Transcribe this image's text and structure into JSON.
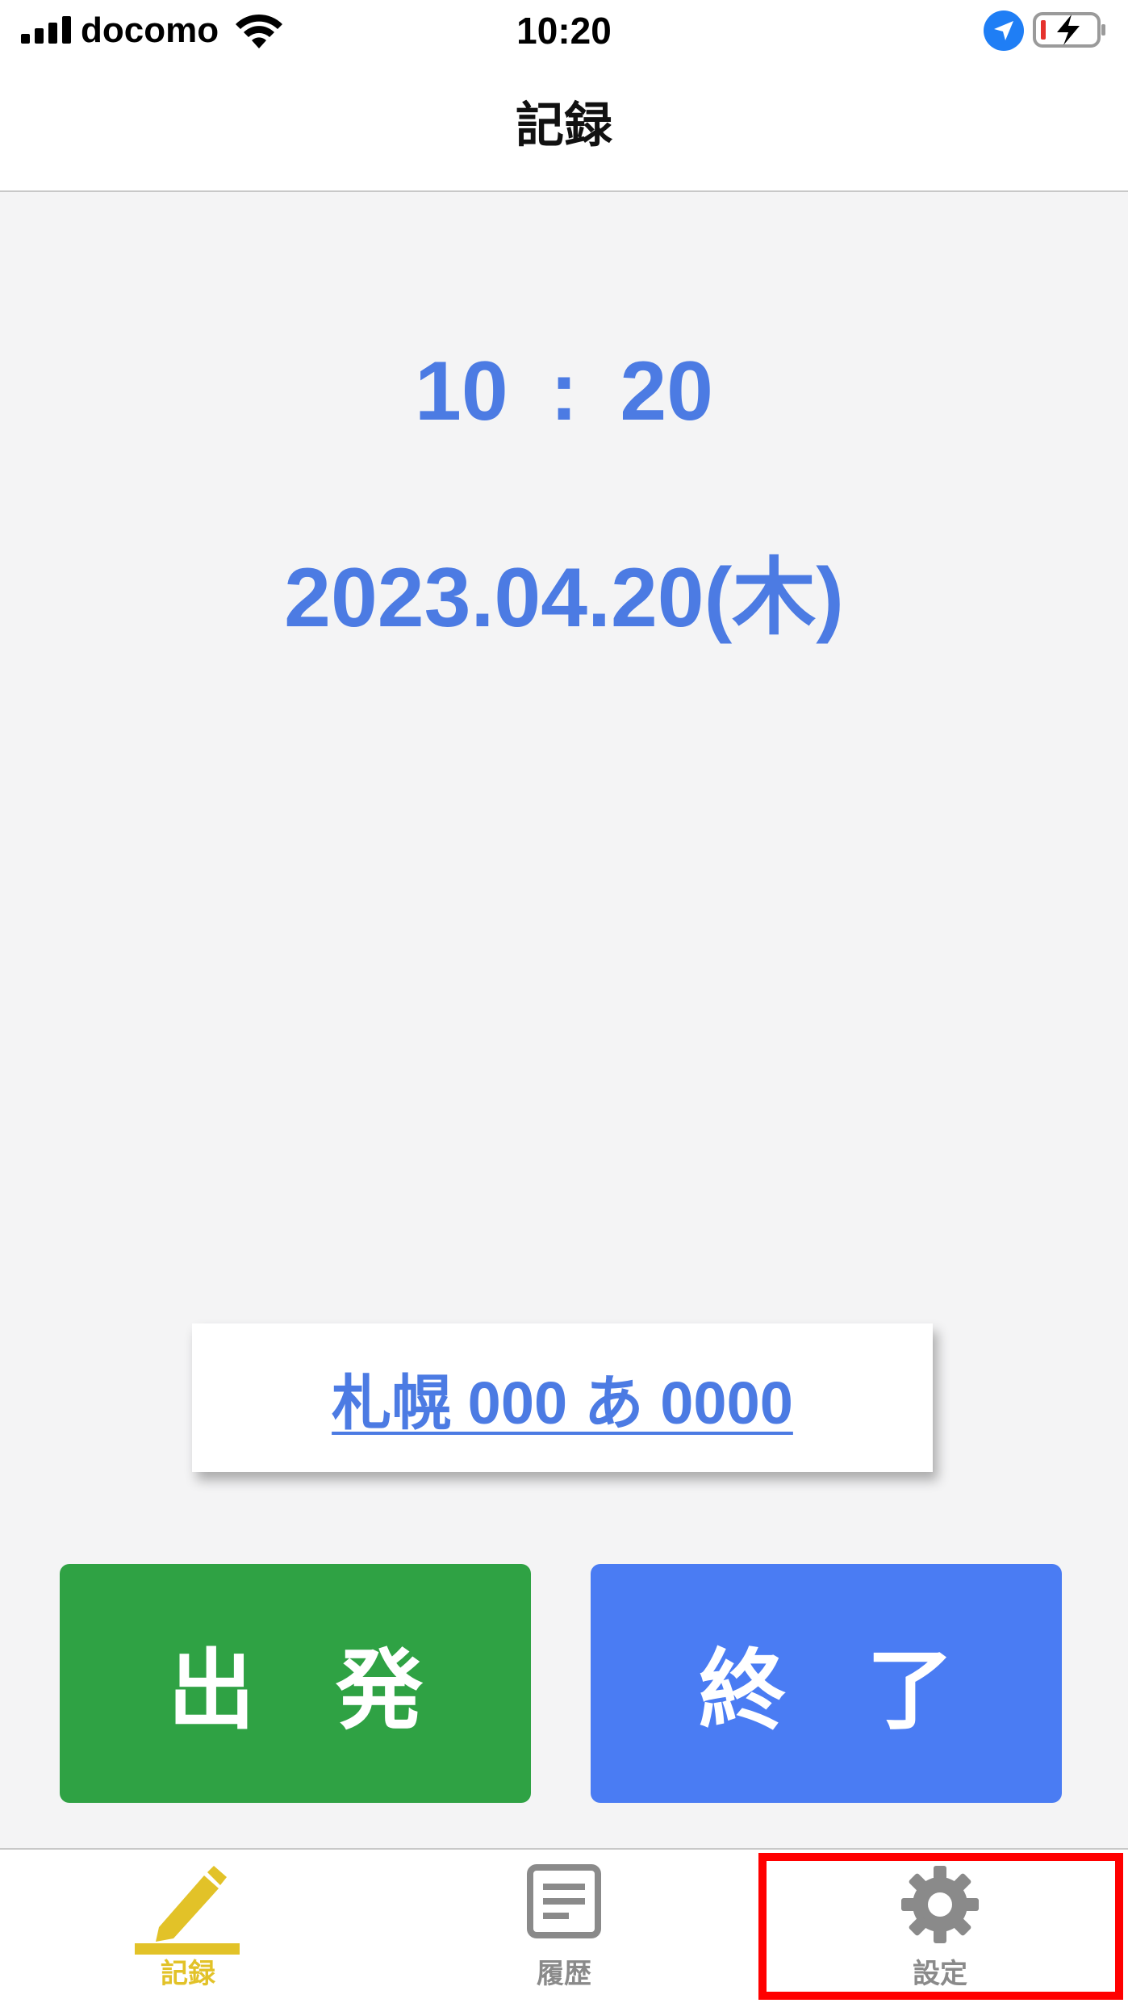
{
  "status_bar": {
    "carrier": "docomo",
    "time": "10:20"
  },
  "nav": {
    "title": "記録"
  },
  "main": {
    "time": "10 : 20",
    "date": "2023.04.20(木)",
    "plate": "札幌 000 あ 0000",
    "depart_label": "出発",
    "finish_label": "終了"
  },
  "tabs": [
    {
      "label": "記録",
      "icon": "pencil-icon",
      "active": true,
      "color": "#e2c228"
    },
    {
      "label": "履歴",
      "icon": "history-icon",
      "active": false,
      "color": "#8a8a8a"
    },
    {
      "label": "設定",
      "icon": "gear-icon",
      "active": false,
      "color": "#8a8a8a"
    }
  ],
  "colors": {
    "accent_blue": "#4c7be3",
    "depart_green": "#2fa244",
    "finish_blue": "#4a7cf3",
    "highlight_red": "#ff0000"
  }
}
